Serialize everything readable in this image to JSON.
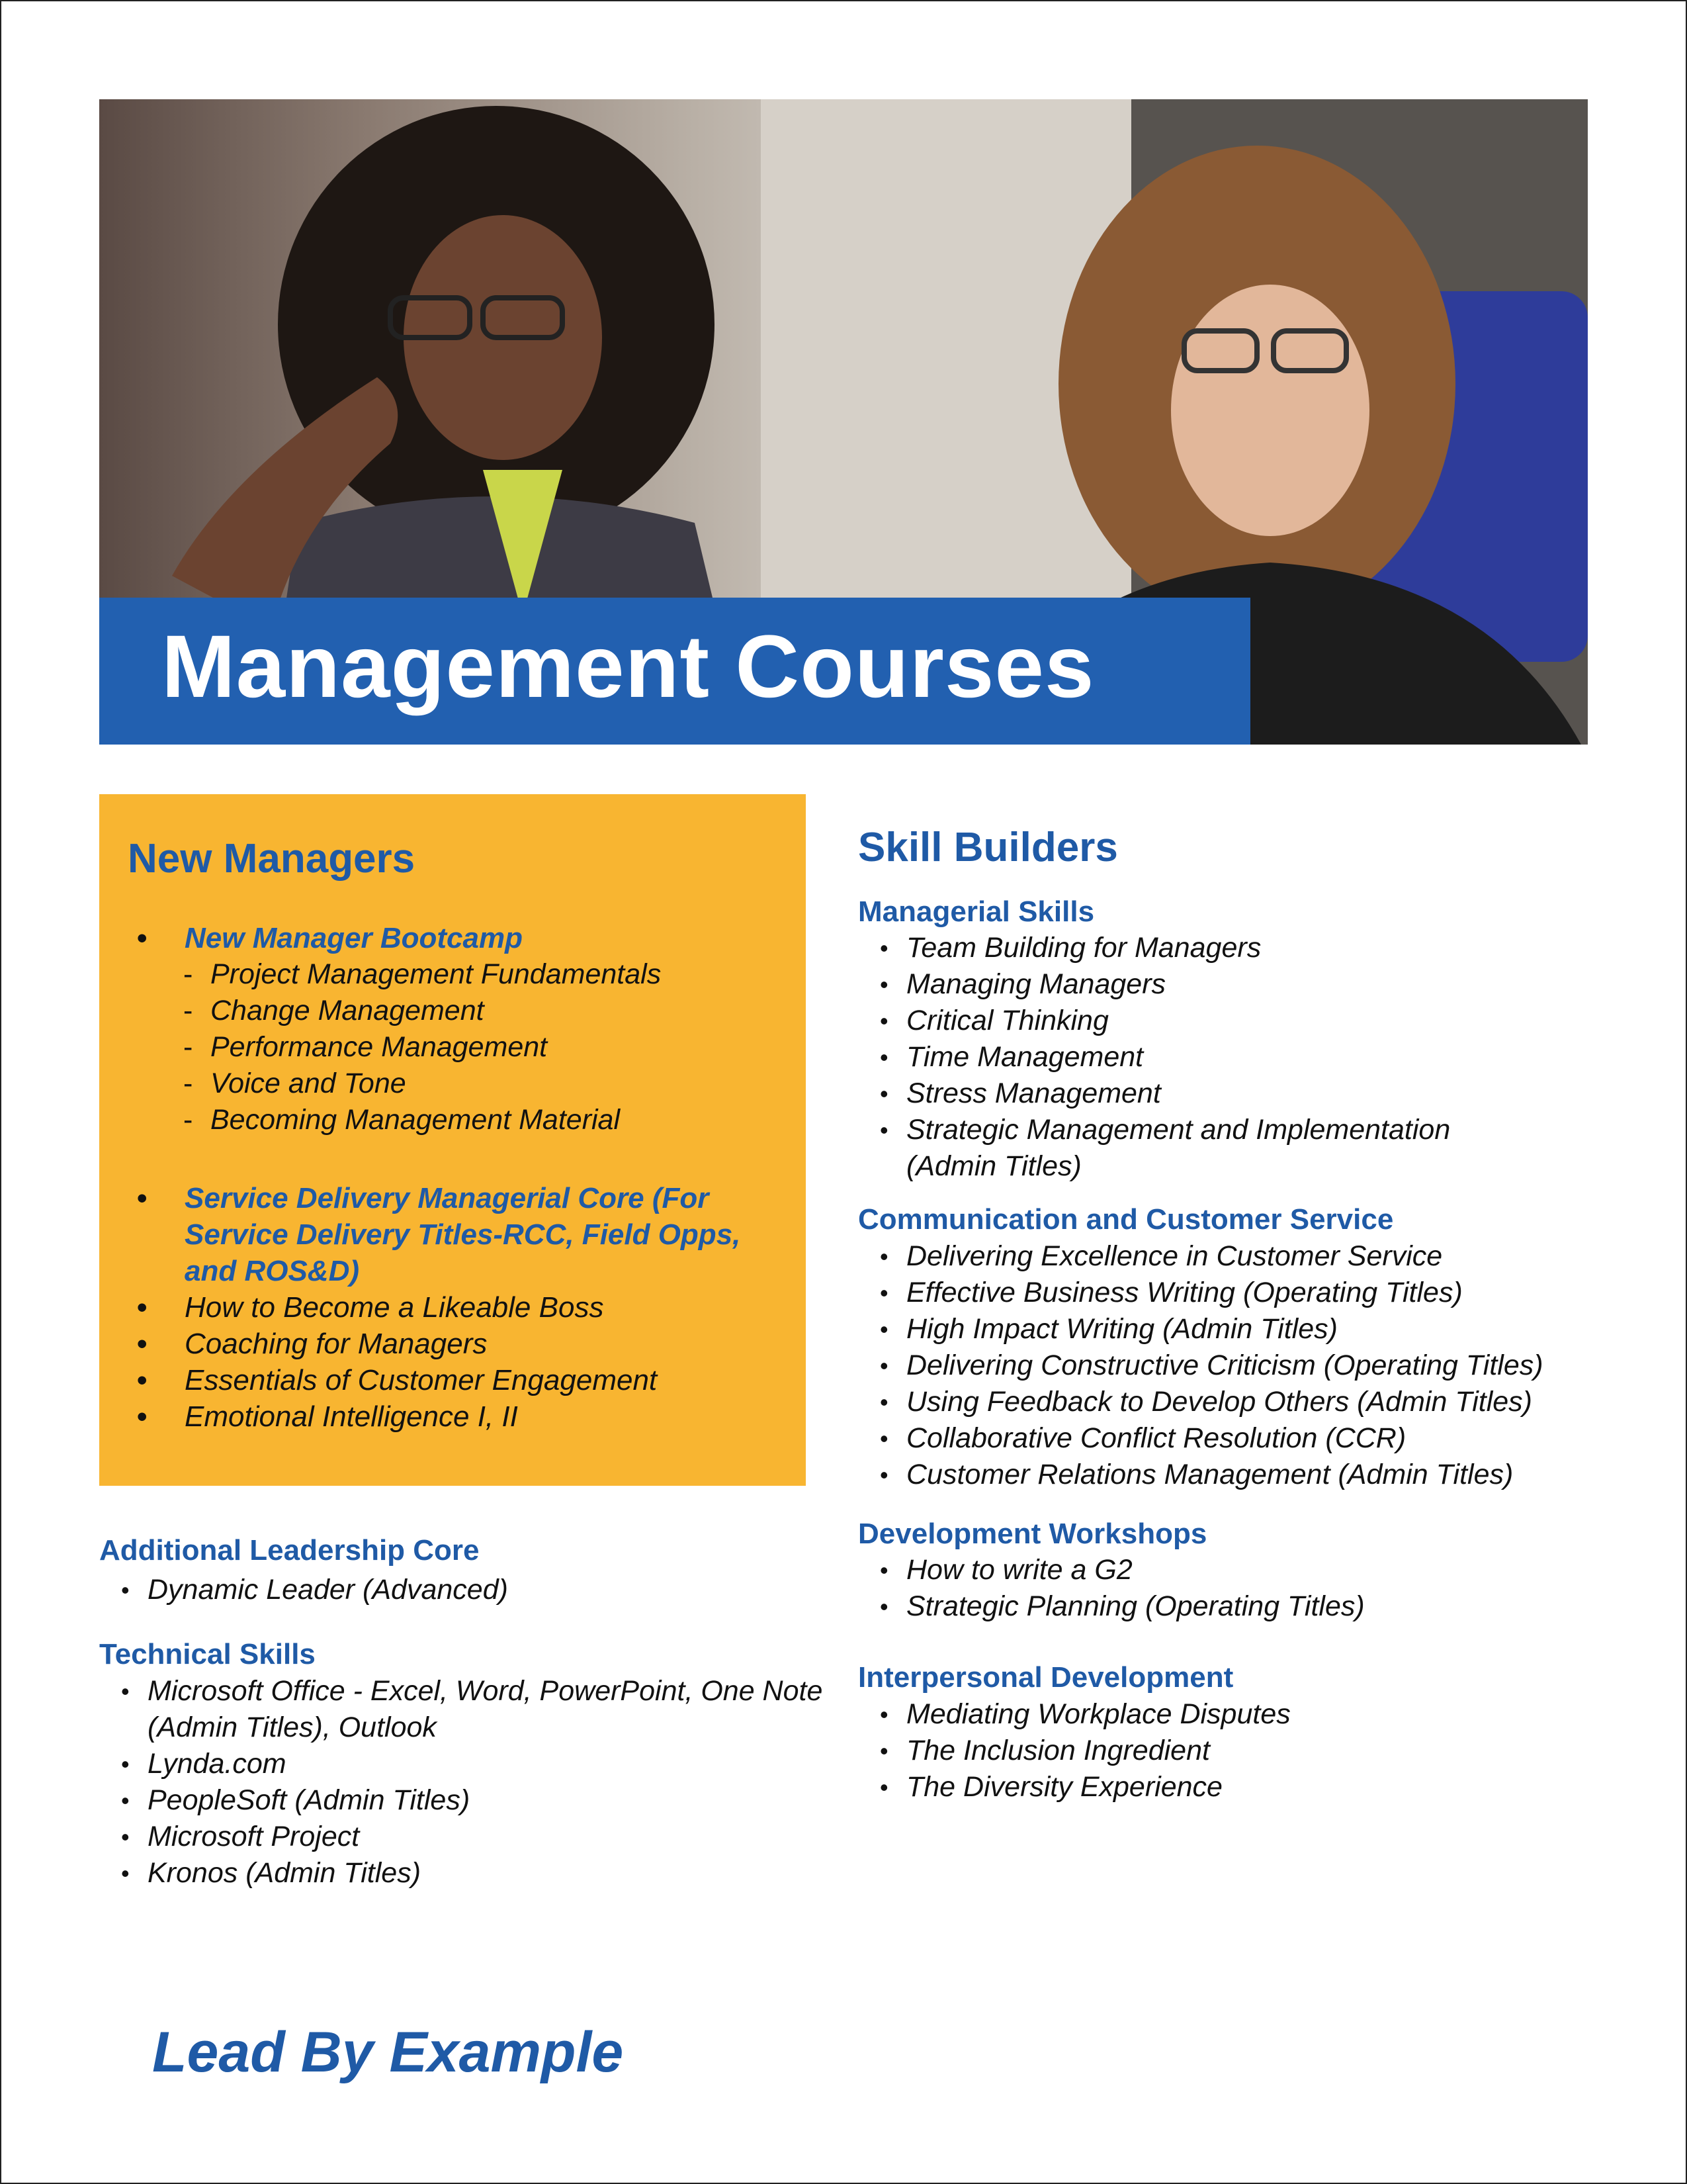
{
  "title": "Management Courses",
  "new_managers": {
    "heading": "New Managers",
    "bootcamp": {
      "label": "New Manager Bootcamp",
      "subitems": [
        "Project Management Fundamentals",
        "Change Management",
        "Performance Management",
        "Voice and Tone",
        "Becoming Management Material"
      ]
    },
    "service_delivery": "Service Delivery Managerial Core (For Service Delivery Titles-RCC, Field Opps, and ROS&D)",
    "items": [
      "How to Become a Likeable Boss",
      "Coaching for Managers",
      "Essentials of Customer Engagement",
      "Emotional Intelligence I, II"
    ]
  },
  "additional_leadership": {
    "heading": "Additional Leadership Core",
    "items": [
      "Dynamic Leader (Advanced)"
    ]
  },
  "technical_skills": {
    "heading": "Technical Skills",
    "items": [
      "Microsoft Office - Excel, Word, PowerPoint, One Note (Admin Titles), Outlook",
      "Lynda.com",
      "PeopleSoft (Admin Titles)",
      "Microsoft Project",
      "Kronos (Admin Titles)"
    ]
  },
  "skill_builders": {
    "heading": "Skill Builders",
    "managerial": {
      "heading": "Managerial Skills",
      "items": [
        "Team Building for Managers",
        "Managing Managers",
        "Critical Thinking",
        "Time Management",
        "Stress Management",
        "Strategic Management and Implementation (Admin Titles)"
      ]
    },
    "communication": {
      "heading": "Communication and Customer Service",
      "items": [
        "Delivering Excellence in Customer Service",
        "Effective Business Writing (Operating Titles)",
        "High Impact Writing (Admin Titles)",
        "Delivering Constructive Criticism (Operating Titles)",
        "Using Feedback to Develop Others (Admin Titles)",
        "Collaborative Conflict Resolution (CCR)",
        "Customer Relations Management (Admin Titles)"
      ]
    },
    "development": {
      "heading": "Development Workshops",
      "items": [
        "How to write a G2",
        "Strategic Planning (Operating Titles)"
      ]
    },
    "interpersonal": {
      "heading": "Interpersonal Development",
      "items": [
        "Mediating Workplace Disputes",
        "The Inclusion Ingredient",
        "The Diversity Experience"
      ]
    }
  },
  "footer": "Lead By Example",
  "colors": {
    "brand_blue": "#2260b0",
    "heading_blue": "#1f5aa6",
    "accent_yellow": "#f8b531"
  }
}
